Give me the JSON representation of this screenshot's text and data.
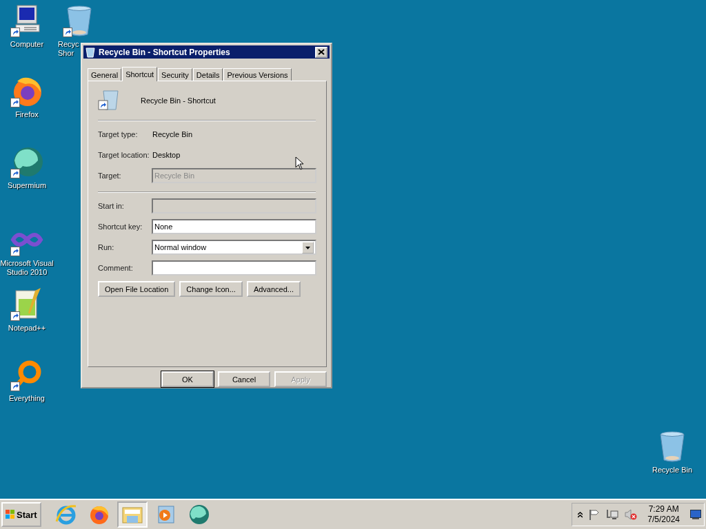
{
  "desktop_icons": [
    {
      "label": "Computer",
      "kind": "computer",
      "shortcut": true
    },
    {
      "label": "Recyc\nShor",
      "kind": "recycle",
      "shortcut": true
    },
    {
      "label": "Firefox",
      "kind": "firefox",
      "shortcut": true
    },
    {
      "label": "Supermium",
      "kind": "supermium",
      "shortcut": true
    },
    {
      "label": "Microsoft Visual Studio 2010",
      "kind": "visualstudio",
      "shortcut": true
    },
    {
      "label": "Notepad++",
      "kind": "notepad",
      "shortcut": true
    },
    {
      "label": "Everything",
      "kind": "everything",
      "shortcut": true
    },
    {
      "label": "Recycle Bin",
      "kind": "recycle",
      "shortcut": false
    }
  ],
  "dialog": {
    "title": "Recycle Bin - Shortcut Properties",
    "tabs": [
      {
        "label": "General",
        "selected": false
      },
      {
        "label": "Shortcut",
        "selected": true
      },
      {
        "label": "Security",
        "selected": false
      },
      {
        "label": "Details",
        "selected": false
      },
      {
        "label": "Previous Versions",
        "selected": false
      }
    ],
    "item_name": "Recycle Bin - Shortcut",
    "info": [
      {
        "label": "Target type:",
        "value": "Recycle Bin"
      },
      {
        "label": "Target location:",
        "value": "Desktop"
      }
    ],
    "target": {
      "label": "Target:",
      "value": "Recycle Bin",
      "disabled": true
    },
    "fields": [
      {
        "label": "Start in:",
        "kind": "text",
        "disabled": true
      },
      {
        "label": "Shortcut key:",
        "kind": "text",
        "value": "None",
        "disabled": false
      },
      {
        "label": "Run:",
        "kind": "dropdown",
        "value": "Normal window",
        "disabled": false
      },
      {
        "label": "Comment:",
        "kind": "text",
        "disabled": false
      }
    ],
    "actions": [
      "Open File Location",
      "Change Icon...",
      "Advanced..."
    ],
    "buttons": [
      {
        "label": "OK",
        "default": true,
        "disabled": false
      },
      {
        "label": "Cancel",
        "default": false,
        "disabled": false
      },
      {
        "label": "Apply",
        "default": false,
        "disabled": true
      }
    ]
  },
  "taskbar": {
    "start": "Start",
    "apps": [
      {
        "kind": "ie",
        "selected": false
      },
      {
        "kind": "firefox",
        "selected": false
      },
      {
        "kind": "explorer",
        "selected": true
      },
      {
        "kind": "mediaplayer",
        "selected": false
      },
      {
        "kind": "supermium",
        "selected": false
      }
    ],
    "tray": {
      "time": "7:29 AM",
      "date": "7/5/2024",
      "sound_muted": true
    }
  }
}
